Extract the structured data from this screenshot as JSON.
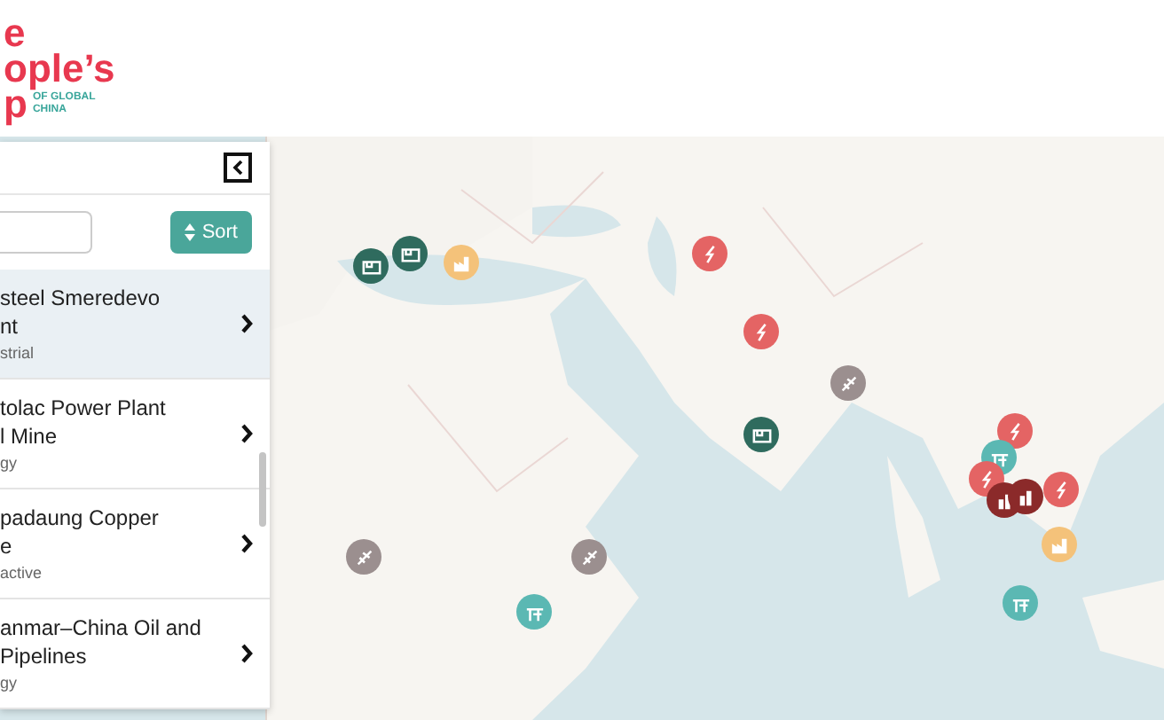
{
  "logo": {
    "lines": [
      "e",
      "ople’s",
      "p"
    ],
    "tagline": [
      "OF GLOBAL",
      "CHINA"
    ]
  },
  "sidebar": {
    "sort_button": "Sort",
    "items": [
      {
        "title": [
          "steel Smeredevo",
          "nt"
        ],
        "category": "strial",
        "selected": true
      },
      {
        "title": [
          "tolac Power Plant",
          "l Mine"
        ],
        "category": "gy",
        "selected": false
      },
      {
        "title": [
          "padaung Copper",
          "e"
        ],
        "category": "active",
        "selected": false
      },
      {
        "title": [
          "anmar–China Oil and",
          "Pipelines"
        ],
        "category": "gy",
        "selected": false
      }
    ]
  },
  "map": {
    "markers": [
      {
        "kind": "dock",
        "color": "#2f6b5e"
      },
      {
        "kind": "dock",
        "color": "#2f6b5e"
      },
      {
        "kind": "factory",
        "color": "#f4c27a"
      },
      {
        "kind": "power",
        "color": "#e46464"
      },
      {
        "kind": "power",
        "color": "#e46464"
      },
      {
        "kind": "plane",
        "color": "#9b8f8f"
      },
      {
        "kind": "dock",
        "color": "#2f6b5e"
      },
      {
        "kind": "power",
        "color": "#e46464"
      },
      {
        "kind": "pump",
        "color": "#5bb8b3"
      },
      {
        "kind": "power",
        "color": "#e46464"
      },
      {
        "kind": "buildings",
        "color": "#8b2a2a"
      },
      {
        "kind": "buildings",
        "color": "#8b2a2a"
      },
      {
        "kind": "power",
        "color": "#e46464"
      },
      {
        "kind": "factory",
        "color": "#f4c27a"
      },
      {
        "kind": "plane",
        "color": "#9b8f8f"
      },
      {
        "kind": "plane",
        "color": "#9b8f8f"
      },
      {
        "kind": "pump",
        "color": "#5bb8b3"
      },
      {
        "kind": "pump",
        "color": "#5bb8b3"
      }
    ]
  }
}
